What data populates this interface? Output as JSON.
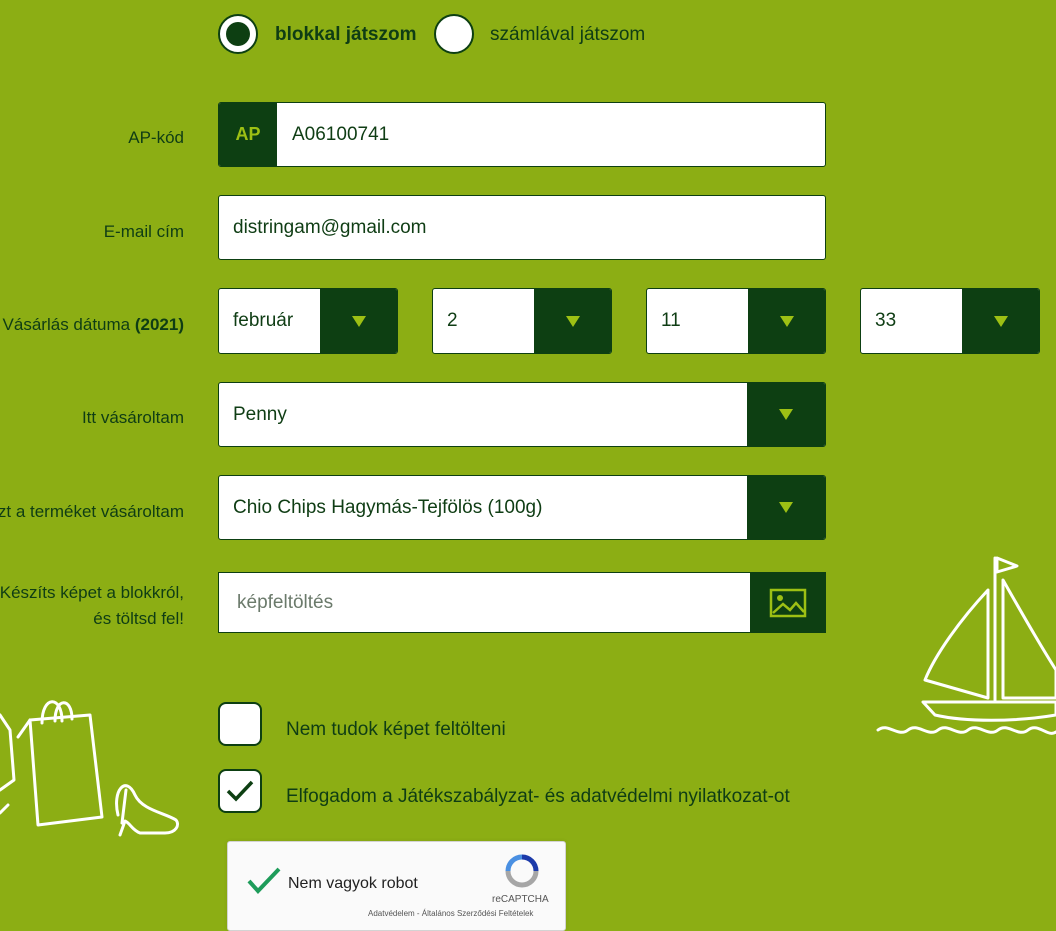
{
  "mode": {
    "receipt_label": "blokkal játszom",
    "invoice_label": "számlával játszom",
    "selected": "receipt"
  },
  "form": {
    "ap_label": "AP-kód",
    "ap_badge": "AP",
    "ap_value": "A06100741",
    "email_label": "E-mail cím",
    "email_value": "distringam@gmail.com",
    "date_label": "Vásárlás dátuma",
    "date_year": "(2021)",
    "date_month": "február",
    "date_day": "2",
    "date_hour": "11",
    "date_minute": "33",
    "store_label": "Itt vásároltam",
    "store_value": "Penny",
    "product_label": "zt a terméket vásároltam",
    "product_value": "Chio Chips Hagymás-Tejfölös (100g)",
    "upload_label_line1": "Készíts képet a blokkról,",
    "upload_label_line2": "és töltsd fel!",
    "upload_placeholder": "képfeltöltés"
  },
  "checks": {
    "no_upload_label": "Nem tudok képet feltölteni",
    "no_upload_checked": false,
    "accept_label": "Elfogadom a Játékszabályzat- és adatvédelmi nyilatkozat-ot",
    "accept_checked": true
  },
  "captcha": {
    "label": "Nem vagyok robot",
    "brand": "reCAPTCHA",
    "footer": "Adatvédelem - Általános Szerződési Feltételek"
  },
  "colors": {
    "background": "#8cae14",
    "dark_green": "#0d3f12",
    "accent": "#9dc014"
  }
}
